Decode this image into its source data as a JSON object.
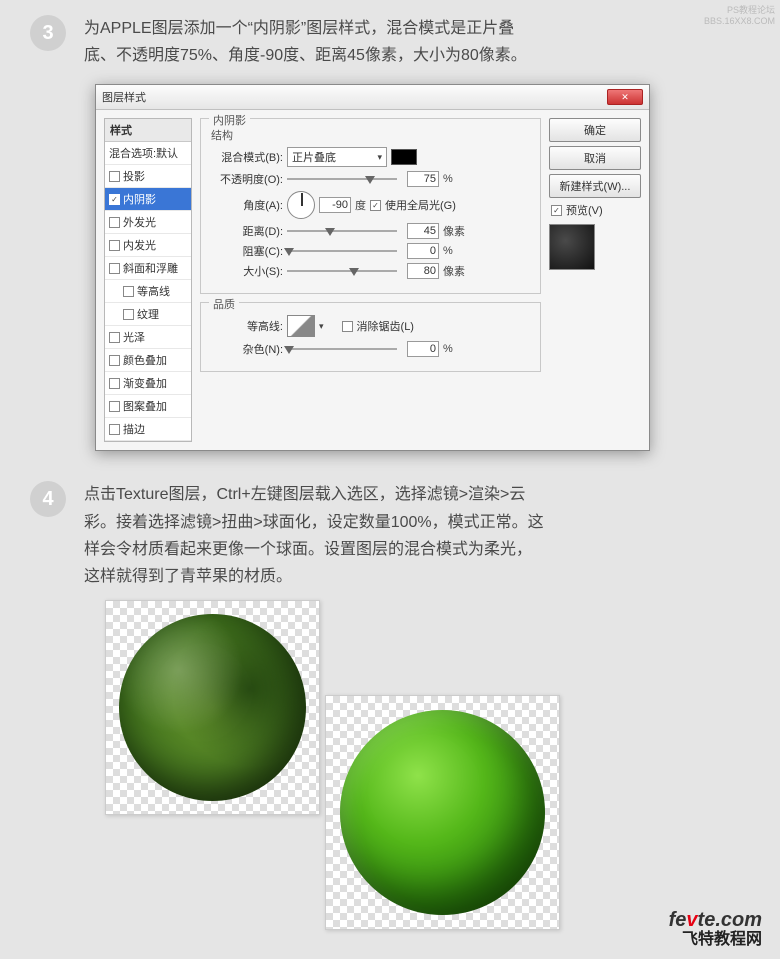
{
  "watermark": {
    "line1": "PS教程论坛",
    "line2": "BBS.16XX8.COM"
  },
  "step3": {
    "num": "3",
    "text": "为APPLE图层添加一个“内阴影”图层样式，混合模式是正片叠底、不透明度75%、角度-90度、距离45像素，大小为80像素。"
  },
  "dialog": {
    "title": "图层样式",
    "close_glyph": "✕",
    "left": {
      "header": "样式",
      "default": "混合选项:默认",
      "items": [
        {
          "label": "投影",
          "checked": false
        },
        {
          "label": "内阴影",
          "checked": true,
          "selected": true
        },
        {
          "label": "外发光",
          "checked": false
        },
        {
          "label": "内发光",
          "checked": false
        },
        {
          "label": "斜面和浮雕",
          "checked": false
        },
        {
          "label": "等高线",
          "checked": false,
          "indent": true
        },
        {
          "label": "纹理",
          "checked": false,
          "indent": true
        },
        {
          "label": "光泽",
          "checked": false
        },
        {
          "label": "颜色叠加",
          "checked": false
        },
        {
          "label": "渐变叠加",
          "checked": false
        },
        {
          "label": "图案叠加",
          "checked": false
        },
        {
          "label": "描边",
          "checked": false
        }
      ]
    },
    "panel": {
      "group_title": "内阴影",
      "structure_label": "结构",
      "blend_label": "混合模式(B):",
      "blend_value": "正片叠底",
      "opacity_label": "不透明度(O):",
      "opacity_value": "75",
      "opacity_unit": "%",
      "angle_label": "角度(A):",
      "angle_value": "-90",
      "angle_unit": "度",
      "global_light": "使用全局光(G)",
      "distance_label": "距离(D):",
      "distance_value": "45",
      "distance_unit": "像素",
      "choke_label": "阻塞(C):",
      "choke_value": "0",
      "choke_unit": "%",
      "size_label": "大小(S):",
      "size_value": "80",
      "size_unit": "像素",
      "quality_label": "品质",
      "contour_label": "等高线:",
      "antialias": "消除锯齿(L)",
      "noise_label": "杂色(N):",
      "noise_value": "0",
      "noise_unit": "%"
    },
    "buttons": {
      "ok": "确定",
      "cancel": "取消",
      "new_style": "新建样式(W)...",
      "preview": "预览(V)"
    }
  },
  "step4": {
    "num": "4",
    "text": "点击Texture图层，Ctrl+左键图层载入选区，选择滤镜>渲染>云彩。接着选择滤镜>扭曲>球面化，设定数量100%，模式正常。这样会令材质看起来更像一个球面。设置图层的混合模式为柔光，这样就得到了青苹果的材质。"
  },
  "footer": {
    "domain_pre": "fe",
    "domain_hi": "v",
    "domain_post": "te.com",
    "tagline": "飞特教程网"
  }
}
